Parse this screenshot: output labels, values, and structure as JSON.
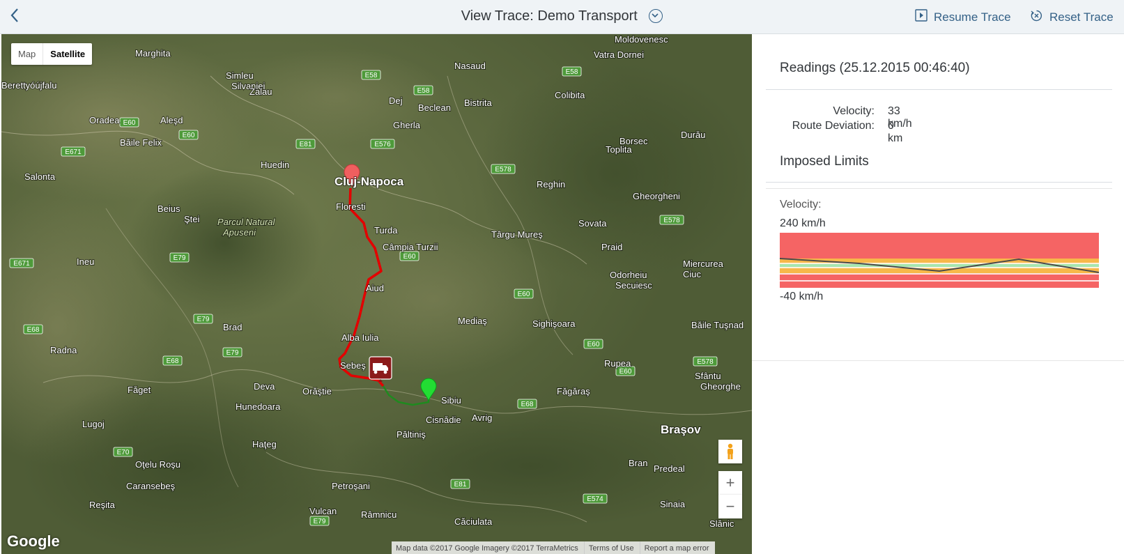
{
  "header": {
    "back_icon": "chevron-left-icon",
    "title": "View Trace: Demo Transport",
    "resume_label": "Resume Trace",
    "reset_label": "Reset Trace"
  },
  "map": {
    "type_map": "Map",
    "type_satellite": "Satellite",
    "zoom_in": "+",
    "zoom_out": "−",
    "logo": "Google",
    "attribution": "Map data ©2017 Google Imagery ©2017 TerraMetrics",
    "terms": "Terms of Use",
    "report": "Report a map error",
    "colors": {
      "route_red": "#e30000",
      "route_green": "#1f8a1f",
      "start_pin": "#ef5f5f",
      "end_pin": "#22dd33",
      "truck": "#8b1a1a"
    },
    "places": [
      {
        "name": "Marghita"
      },
      {
        "name": "Nasaud"
      },
      {
        "name": "Vatra Dornei"
      },
      {
        "name": "Moldovenesc"
      },
      {
        "name": "Simleu Silvaniei"
      },
      {
        "name": "Zalau"
      },
      {
        "name": "Dej"
      },
      {
        "name": "Beclean"
      },
      {
        "name": "Bistrita"
      },
      {
        "name": "Colibita"
      },
      {
        "name": "Berettyóújfalu"
      },
      {
        "name": "Oradea"
      },
      {
        "name": "Aleşd"
      },
      {
        "name": "Băile Felix"
      },
      {
        "name": "Gherla"
      },
      {
        "name": "Borsec"
      },
      {
        "name": "Durău"
      },
      {
        "name": "Huedin"
      },
      {
        "name": "Cluj-Napoca"
      },
      {
        "name": "Toplita"
      },
      {
        "name": "Salonta"
      },
      {
        "name": "Reghin"
      },
      {
        "name": "Gheorgheni"
      },
      {
        "name": "Beius"
      },
      {
        "name": "Floresti"
      },
      {
        "name": "Parcul Natural Apuseni"
      },
      {
        "name": "Ştei"
      },
      {
        "name": "Turda"
      },
      {
        "name": "Sovata"
      },
      {
        "name": "Câmpia Turzii"
      },
      {
        "name": "Târgu Mureş"
      },
      {
        "name": "Praid"
      },
      {
        "name": "Ineu"
      },
      {
        "name": "Miercurea Ciuc"
      },
      {
        "name": "Odorheiu Secuiesc"
      },
      {
        "name": "Aiud"
      },
      {
        "name": "Brad"
      },
      {
        "name": "Mediaş"
      },
      {
        "name": "Sighişoara"
      },
      {
        "name": "Băile Tuşnad"
      },
      {
        "name": "Radna"
      },
      {
        "name": "Alba Iulia"
      },
      {
        "name": "Rupea"
      },
      {
        "name": "Sebeş"
      },
      {
        "name": "Sfântu Gheorghe"
      },
      {
        "name": "Făget"
      },
      {
        "name": "Deva"
      },
      {
        "name": "Orăştie"
      },
      {
        "name": "Sibiu"
      },
      {
        "name": "Făgăraş"
      },
      {
        "name": "Hunedoara"
      },
      {
        "name": "Cisnădie"
      },
      {
        "name": "Avrig"
      },
      {
        "name": "Lugoj"
      },
      {
        "name": "Braşov"
      },
      {
        "name": "Păltiniş"
      },
      {
        "name": "Haţeg"
      },
      {
        "name": "Oţelu Roşu"
      },
      {
        "name": "Bran"
      },
      {
        "name": "Predeal"
      },
      {
        "name": "Caransebeş"
      },
      {
        "name": "Petroşani"
      },
      {
        "name": "Reşita"
      },
      {
        "name": "Vulcan"
      },
      {
        "name": "Sinaia"
      },
      {
        "name": "Râmnicu"
      },
      {
        "name": "Căciulata"
      },
      {
        "name": "Slănic"
      }
    ],
    "roads": [
      {
        "label": "E58"
      },
      {
        "label": "E58"
      },
      {
        "label": "E58"
      },
      {
        "label": "E60"
      },
      {
        "label": "E60"
      },
      {
        "label": "E81"
      },
      {
        "label": "E576"
      },
      {
        "label": "E671"
      },
      {
        "label": "E578"
      },
      {
        "label": "E578"
      },
      {
        "label": "E79"
      },
      {
        "label": "E60"
      },
      {
        "label": "E671"
      },
      {
        "label": "E60"
      },
      {
        "label": "E79"
      },
      {
        "label": "E68"
      },
      {
        "label": "E79"
      },
      {
        "label": "E60"
      },
      {
        "label": "E578"
      },
      {
        "label": "E68"
      },
      {
        "label": "E60"
      },
      {
        "label": "E68"
      },
      {
        "label": "E70"
      },
      {
        "label": "E81"
      },
      {
        "label": "E574"
      },
      {
        "label": "E79"
      }
    ]
  },
  "readings": {
    "title": "Readings (25.12.2015 00:46:40)",
    "velocity_label": "Velocity:",
    "velocity_value": "33 km/h",
    "deviation_label": "Route Deviation:",
    "deviation_value": "0 km"
  },
  "limits": {
    "title": "Imposed Limits",
    "velocity_label": "Velocity:",
    "max_label": "240 km/h",
    "min_label": "-40 km/h",
    "chart_colors": {
      "red": "#f56464",
      "orange": "#f7b84a",
      "green": "#a6e6b0",
      "line": "#4a4a4a"
    }
  }
}
